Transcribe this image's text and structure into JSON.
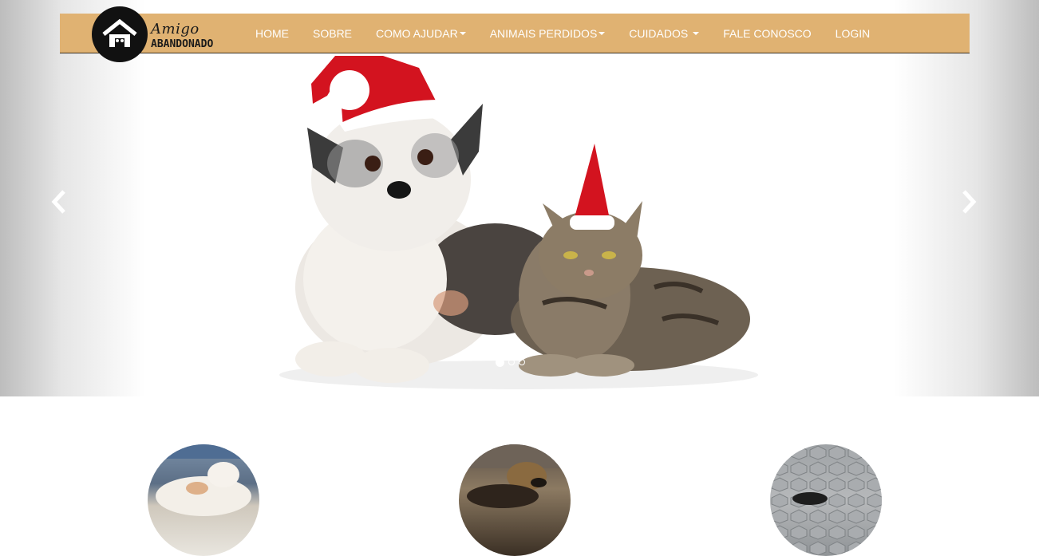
{
  "brand": {
    "name_line1": "Amigo",
    "name_line2": "ABANDONADO",
    "logo_icon": "house-paw-icon"
  },
  "nav": {
    "items": [
      {
        "label": "HOME",
        "dropdown": false
      },
      {
        "label": "SOBRE",
        "dropdown": false
      },
      {
        "label": "COMO AJUDAR",
        "dropdown": true
      },
      {
        "label": "ANIMAIS PERDIDOS",
        "dropdown": true
      },
      {
        "label": "CUIDADOS",
        "dropdown": true
      },
      {
        "label": "FALE CONOSCO",
        "dropdown": false
      },
      {
        "label": "LOGIN",
        "dropdown": false
      }
    ]
  },
  "carousel": {
    "slide_count": 3,
    "active_index": 0,
    "prev_icon": "chevron-left-icon",
    "next_icon": "chevron-right-icon"
  },
  "features": [
    {
      "name": "white-dog"
    },
    {
      "name": "brown-dog"
    },
    {
      "name": "black-dog"
    }
  ],
  "colors": {
    "navbar_bg": "#e0b272",
    "nav_text": "#ffffff",
    "santa_hat_red": "#d3131f"
  }
}
